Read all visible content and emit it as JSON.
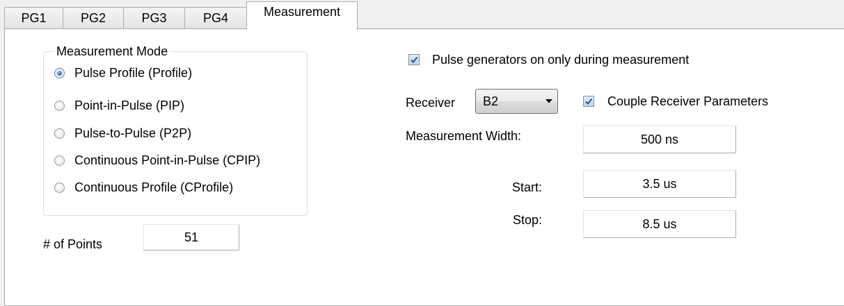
{
  "tabs": [
    {
      "label": "PG1",
      "active": false
    },
    {
      "label": "PG2",
      "active": false
    },
    {
      "label": "PG3",
      "active": false
    },
    {
      "label": "PG4",
      "active": false
    },
    {
      "label": "Measurement",
      "active": true
    }
  ],
  "measurement_mode": {
    "title": "Measurement Mode",
    "selected": "Pulse Profile (Profile)",
    "options": [
      {
        "label": "Pulse Profile (Profile)",
        "checked": true
      },
      {
        "label": "Point-in-Pulse (PIP)",
        "checked": false
      },
      {
        "label": "Pulse-to-Pulse (P2P)",
        "checked": false
      },
      {
        "label": "Continuous Point-in-Pulse (CPIP)",
        "checked": false
      },
      {
        "label": "Continuous Profile (CProfile)",
        "checked": false
      }
    ]
  },
  "points": {
    "label": "# of Points",
    "value": "51"
  },
  "pulse_generators_checkbox": {
    "label": "Pulse generators on only during measurement",
    "checked": true
  },
  "receiver": {
    "label": "Receiver",
    "value": "B2"
  },
  "couple_receiver_checkbox": {
    "label": "Couple Receiver Parameters",
    "checked": true
  },
  "measurement_width": {
    "label": "Measurement Width:",
    "value": "500 ns"
  },
  "start": {
    "label": "Start:",
    "value": "3.5 us"
  },
  "stop": {
    "label": "Stop:",
    "value": "8.5 us"
  },
  "icons": {
    "checkmark": "checkmark-icon",
    "dropdown": "chevron-down-icon"
  },
  "colors": {
    "accent": "#2a6fc9",
    "checkbox_fill": "#c9e0fa",
    "panel": "#ffffff",
    "background": "#f0f0f0"
  }
}
